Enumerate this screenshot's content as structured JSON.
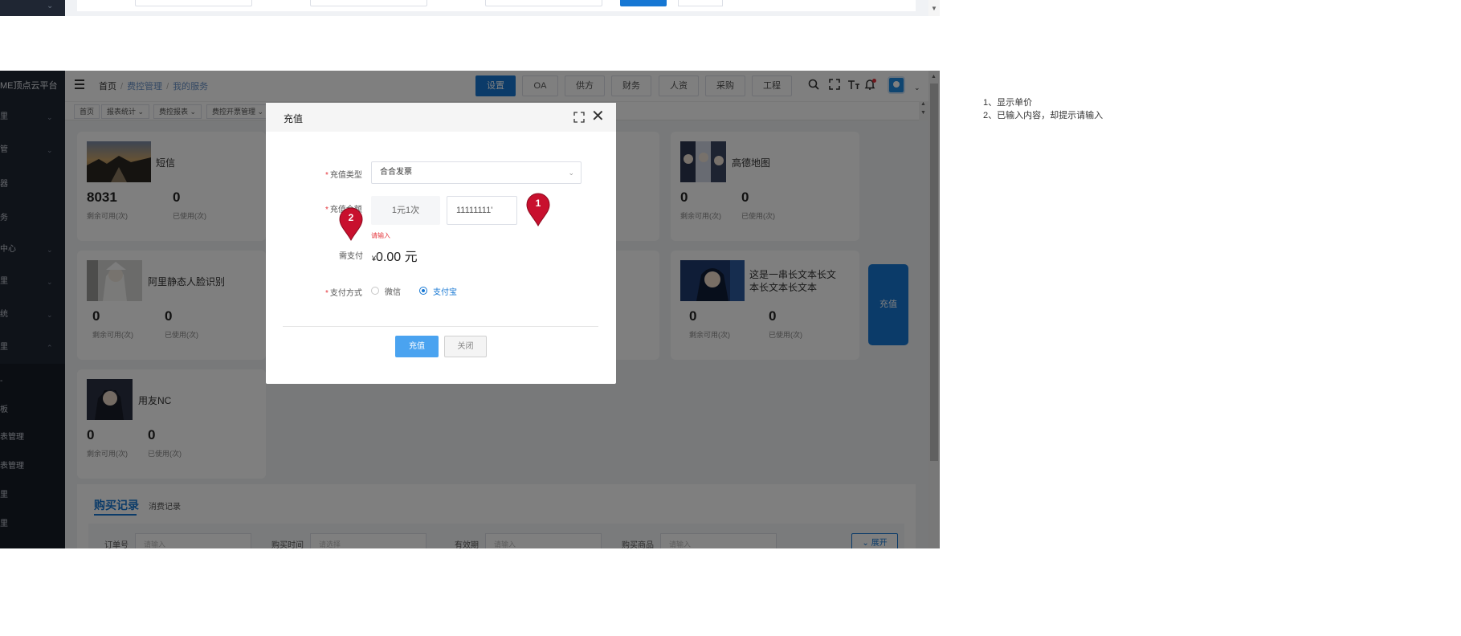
{
  "topstrip": {
    "chevron": "⌄"
  },
  "sidebar": {
    "brand": "ME顶点云平台",
    "items": [
      {
        "label": "里",
        "arrow": "⌄"
      },
      {
        "label": "管",
        "arrow": "⌄"
      },
      {
        "label": "器",
        "arrow": ""
      },
      {
        "label": "务",
        "arrow": ""
      },
      {
        "label": "中心",
        "arrow": "⌄"
      },
      {
        "label": "里",
        "arrow": "⌄"
      },
      {
        "label": "统",
        "arrow": "⌄"
      },
      {
        "label": "里",
        "arrow": "⌃"
      }
    ],
    "sub_items": [
      "-",
      "板",
      "表管理",
      "表管理",
      "里",
      "里"
    ]
  },
  "header": {
    "breadcrumb": {
      "home": "首页",
      "sep": "/",
      "level1": "费控管理",
      "level2": "我的服务"
    },
    "modules": [
      "设置",
      "OA",
      "供方",
      "财务",
      "人资",
      "采购",
      "工程"
    ],
    "active_module": "设置",
    "caret": "⌄"
  },
  "tags": [
    {
      "label": "首页"
    },
    {
      "label": "报表统计 ⌄"
    },
    {
      "label": "费控报表 ⌄"
    },
    {
      "label": "费控开票管理 ⌄"
    }
  ],
  "cards": [
    {
      "title": "短信",
      "remain": "8031",
      "used": "0",
      "remain_label": "剩余可用(次)",
      "used_label": "已使用(次)"
    },
    {
      "title": "阿里静态人脸识别",
      "remain": "0",
      "used": "0",
      "remain_label": "剩余可用(次)",
      "used_label": "已使用(次)"
    },
    {
      "title": "用友NC",
      "remain": "0",
      "used": "0",
      "remain_label": "剩余可用(次)",
      "used_label": "已使用(次)"
    },
    {
      "title": "高德地图",
      "remain": "0",
      "used": "0",
      "remain_label": "剩余可用(次)",
      "used_label": "已使用(次)"
    },
    {
      "title": "这是一串长文本长文本长文本长文本",
      "remain": "0",
      "used": "0",
      "remain_label": "剩余可用(次)",
      "used_label": "已使用(次)"
    }
  ],
  "side_recharge_label": "充值",
  "bottom": {
    "tabs": [
      "购买记录",
      "消费记录"
    ],
    "filters": [
      {
        "label": "订单号",
        "placeholder": "请输入"
      },
      {
        "label": "购买时间",
        "placeholder": "请选择"
      },
      {
        "label": "有效期",
        "placeholder": "请输入"
      },
      {
        "label": "购买商品",
        "placeholder": "请输入"
      }
    ],
    "expand_label": "⌄ 展开"
  },
  "modal": {
    "title": "充值",
    "close_glyph": "✕",
    "type_label": "充值类型",
    "type_value": "合合发票",
    "type_arrow": "⌄",
    "amount_label": "充值金额",
    "unit_price": "1元1次",
    "amount_value": "11111111'",
    "error_text": "请输入",
    "pay_label": "需支付",
    "currency": "¥",
    "pay_value": "0.00 元",
    "method_label": "支付方式",
    "methods": [
      {
        "label": "微信",
        "selected": false
      },
      {
        "label": "支付宝",
        "selected": true
      }
    ],
    "required_mark": "*",
    "submit_label": "充值",
    "close_label": "关闭"
  },
  "pins": [
    {
      "number": "1"
    },
    {
      "number": "2"
    }
  ],
  "notes": [
    "1、显示单价",
    "2、已输入内容，却提示请输入"
  ],
  "colors": {
    "primary": "#1677d3",
    "sidebar": "#1f2633",
    "error": "#e5393f",
    "pin": "#c8102e"
  }
}
